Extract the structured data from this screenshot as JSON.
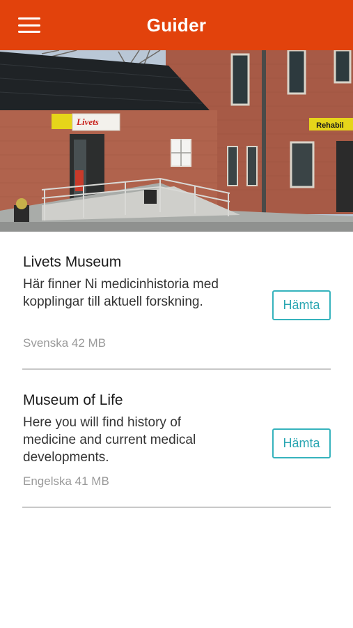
{
  "header": {
    "title": "Guider",
    "background_color": "#e2420c",
    "menu_icon": "hamburger-menu-icon"
  },
  "hero": {
    "sign_text": "Livets",
    "right_sign_text": "Rehabil"
  },
  "guides": [
    {
      "name": "Livets Museum",
      "description": "Här finner Ni medicinhistoria med kopplingar till aktuell forskning.",
      "meta": "Svenska 42 MB",
      "button_label": "Hämta"
    },
    {
      "name": "Museum of Life",
      "description": "Here you will find history of medicine and current medical developments.",
      "meta": "Engelska 41 MB",
      "button_label": "Hämta"
    }
  ],
  "colors": {
    "accent": "#e2420c",
    "button": "#36b3bd",
    "divider": "#c8c8c8"
  }
}
